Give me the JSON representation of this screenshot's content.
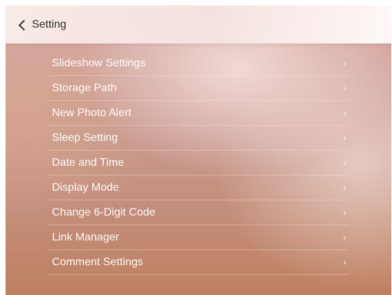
{
  "header": {
    "title": "Setting"
  },
  "menu": {
    "chevron": "›",
    "items": [
      {
        "label": "Slideshow Settings"
      },
      {
        "label": "Storage Path"
      },
      {
        "label": "New Photo Alert"
      },
      {
        "label": "Sleep Setting"
      },
      {
        "label": "Date and Time"
      },
      {
        "label": "Display Mode"
      },
      {
        "label": "Change 6-Digit Code"
      },
      {
        "label": "Link Manager"
      },
      {
        "label": "Comment Settings"
      }
    ]
  },
  "colors": {
    "text_dark": "#2e2e2e",
    "text_light": "#ffffff",
    "bg_top": "#d9aca5",
    "bg_bottom": "#bf8060"
  },
  "icons": {
    "back": "chevron-left-icon",
    "item": "chevron-right-icon"
  }
}
